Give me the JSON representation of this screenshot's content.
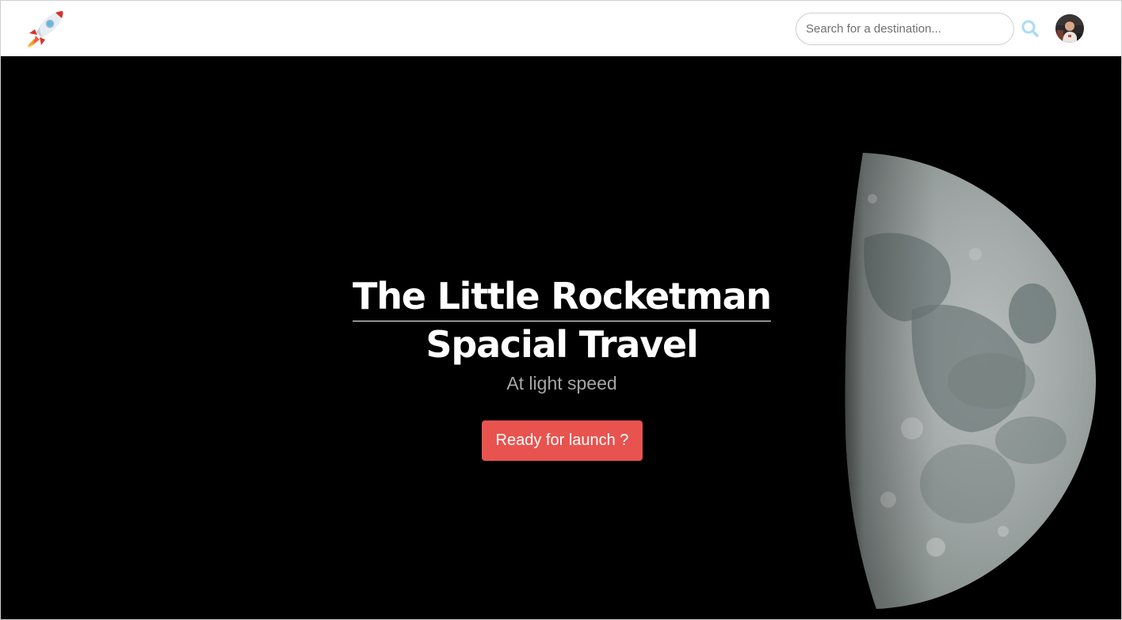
{
  "navbar": {
    "logo_icon": "rocket-icon",
    "search": {
      "placeholder": "Search for a destination...",
      "value": "",
      "button_icon": "search-icon"
    },
    "avatar_icon": "user-avatar"
  },
  "hero": {
    "title_line_1": "The Little Rocketman",
    "title_line_2": "Spacial Travel",
    "subtitle": "At light speed",
    "cta_label": "Ready for launch ?",
    "background_image": "moon-image"
  },
  "colors": {
    "accent": "#e8534f",
    "search_icon": "#a9ddf2",
    "hero_background": "#000000",
    "subtitle": "#a6a6a6"
  }
}
